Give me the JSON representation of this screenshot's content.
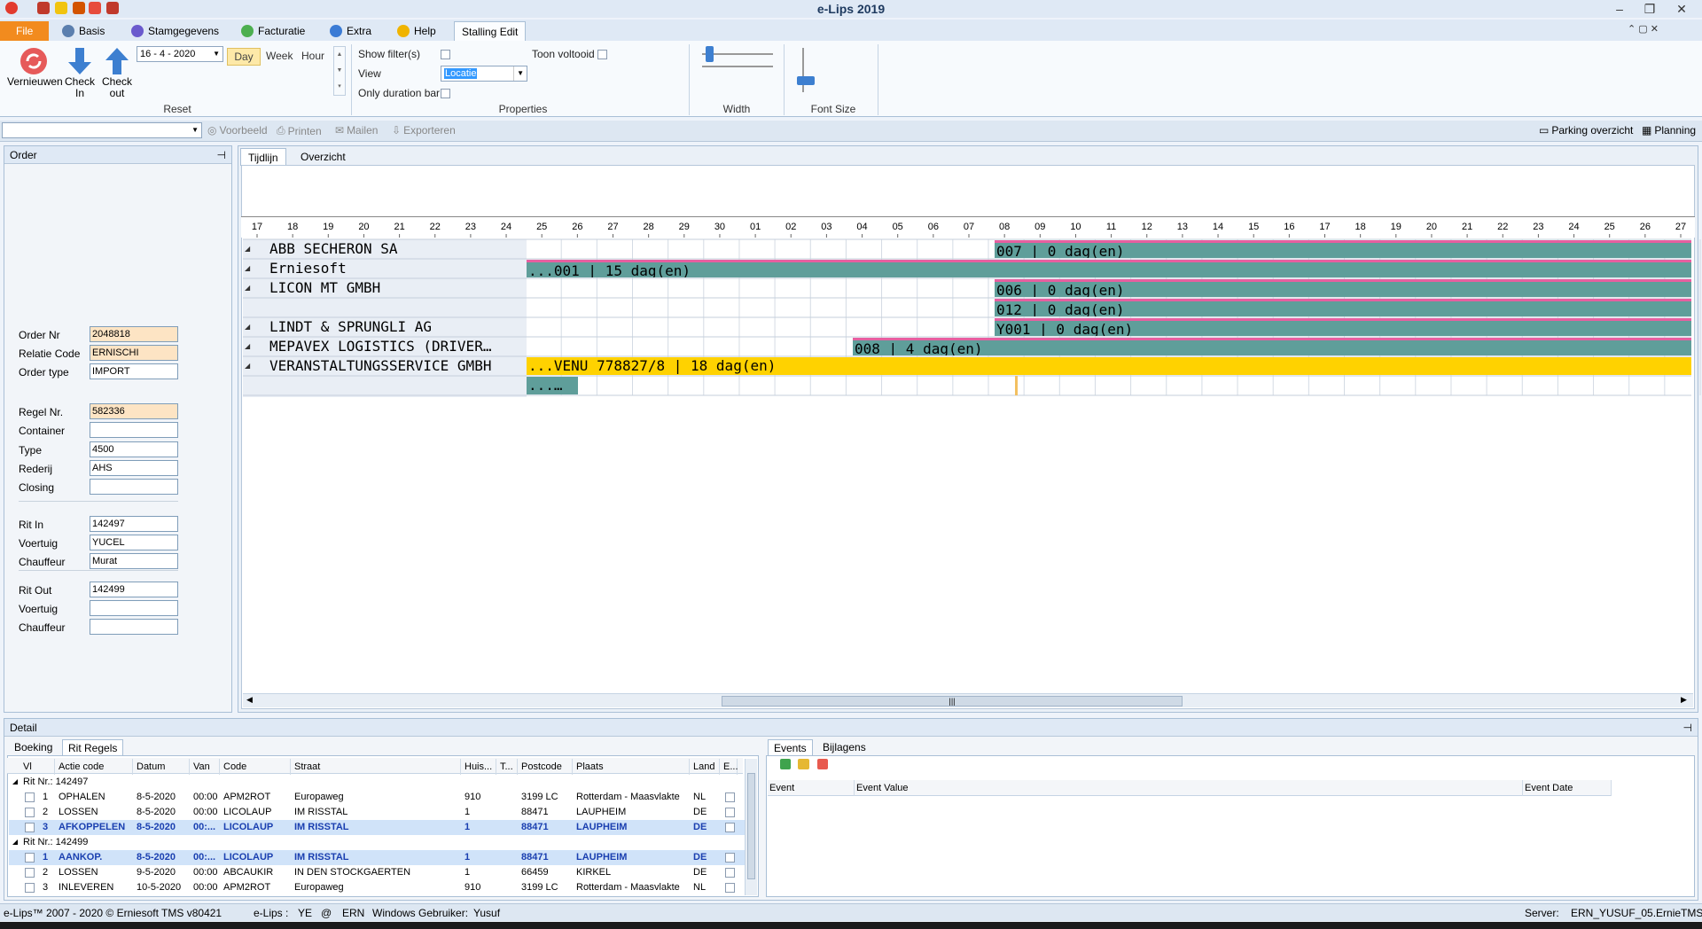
{
  "app": {
    "title": "e-Lips 2019"
  },
  "tabs": [
    "File",
    "Basis",
    "Stamgegevens",
    "Facturatie",
    "Extra",
    "Help",
    "Stalling Edit"
  ],
  "ribbon": {
    "reset": {
      "refresh": "Vernieuwen",
      "checkin": "Check\nIn",
      "checkout": "Check\nout",
      "date": "16 -  4 - 2020",
      "label": "Reset"
    },
    "views": {
      "day": "Day",
      "week": "Week",
      "hour": "Hour"
    },
    "properties": {
      "show_filters": "Show filter(s)",
      "toon_voltooid": "Toon voltooid",
      "view_label": "View",
      "view_value": "Locatie",
      "only_duration": "Only duration bar",
      "label": "Properties"
    },
    "width_label": "Width",
    "fontsize_label": "Font Size"
  },
  "toolbar2": {
    "preview": "Voorbeeld",
    "print": "Printen",
    "mail": "Mailen",
    "export": "Exporteren",
    "parking": "Parking overzicht",
    "planning": "Planning"
  },
  "order": {
    "title": "Order",
    "fields": [
      {
        "label": "Order Nr",
        "value": "2048818"
      },
      {
        "label": "Relatie Code",
        "value": "ERNISCHI"
      },
      {
        "label": "Order type",
        "value": "IMPORT"
      },
      {
        "label": "Regel Nr.",
        "value": "582336"
      },
      {
        "label": "Container",
        "value": ""
      },
      {
        "label": "Type",
        "value": "4500"
      },
      {
        "label": "Rederij",
        "value": "AHS"
      },
      {
        "label": "Closing",
        "value": ""
      },
      {
        "label": "Rit In",
        "value": "142497"
      },
      {
        "label": "Voertuig",
        "value": "YUCEL"
      },
      {
        "label": "Chauffeur",
        "value": "Murat"
      },
      {
        "label": "Rit Out",
        "value": "142499"
      },
      {
        "label": "Voertuig",
        "value": ""
      },
      {
        "label": "Chauffeur",
        "value": ""
      }
    ]
  },
  "timeline": {
    "tabs": [
      "Tijdlijn",
      "Overzicht"
    ],
    "ticks": [
      "17",
      "18",
      "19",
      "20",
      "21",
      "22",
      "23",
      "24",
      "25",
      "26",
      "27",
      "28",
      "29",
      "30",
      "01",
      "02",
      "03",
      "04",
      "05",
      "06",
      "07",
      "08",
      "09",
      "10",
      "11",
      "12",
      "13",
      "14",
      "15",
      "16",
      "17",
      "18",
      "19",
      "20",
      "21",
      "22",
      "23",
      "24",
      "25",
      "26",
      "27"
    ],
    "rows": [
      {
        "label": "ABB SECHERON SA",
        "bar": "007 | 0 dag(en)"
      },
      {
        "label": "Erniesoft",
        "bar": "...001 | 15 dag(en)"
      },
      {
        "label": "LICON MT GMBH",
        "bar": "006 | 0 dag(en)"
      },
      {
        "label": "",
        "bar": "012 | 0 dag(en)"
      },
      {
        "label": "LINDT & SPRUNGLI AG",
        "bar": "Y001 | 0 dag(en)"
      },
      {
        "label": "MEPAVEX LOGISTICS (DRIVER…",
        "bar": "008 | 4 dag(en)"
      },
      {
        "label": "VERANSTALTUNGSSERVICE GMBH",
        "bar": "...VENU 778827/8 | 18 dag(en)"
      },
      {
        "label": "",
        "bar": "...…"
      }
    ],
    "colors": {
      "teal": "#5f9e9a",
      "pink": "#e75fa0",
      "yellow": "#ffd200"
    }
  },
  "detail": {
    "title": "Detail",
    "tabs": [
      "Boeking",
      "Rit Regels"
    ],
    "columns": [
      "Vl",
      "Actie code",
      "Datum",
      "Van",
      "Code",
      "Straat",
      "Huis...",
      "T...",
      "Postcode",
      "Plaats",
      "Land",
      "E..."
    ],
    "groups": [
      {
        "header": "Rit Nr.: 142497",
        "rows": [
          [
            "1",
            "OPHALEN",
            "8-5-2020",
            "00:00",
            "APM2ROT",
            "Europaweg",
            "910",
            "",
            "3199 LC",
            "Rotterdam - Maasvlakte",
            "NL"
          ],
          [
            "2",
            "LOSSEN",
            "8-5-2020",
            "00:00",
            "LICOLAUP",
            "IM RISSTAL",
            "1",
            "",
            "88471",
            "LAUPHEIM",
            "DE"
          ],
          [
            "3",
            "AFKOPPELEN",
            "8-5-2020",
            "00:...",
            "LICOLAUP",
            "IM RISSTAL",
            "1",
            "",
            "88471",
            "LAUPHEIM",
            "DE"
          ]
        ]
      },
      {
        "header": "Rit Nr.: 142499",
        "rows": [
          [
            "1",
            "AANKOP.",
            "8-5-2020",
            "00:...",
            "LICOLAUP",
            "IM RISSTAL",
            "1",
            "",
            "88471",
            "LAUPHEIM",
            "DE"
          ],
          [
            "2",
            "LOSSEN",
            "9-5-2020",
            "00:00",
            "ABCAUKIR",
            "IN DEN STOCKGAERTEN",
            "1",
            "",
            "66459",
            "KIRKEL",
            "DE"
          ],
          [
            "3",
            "INLEVEREN",
            "10-5-2020",
            "00:00",
            "APM2ROT",
            "Europaweg",
            "910",
            "",
            "3199 LC",
            "Rotterdam - Maasvlakte",
            "NL"
          ]
        ]
      }
    ]
  },
  "events": {
    "tabs": [
      "Events",
      "Bijlagens"
    ],
    "columns": [
      "Event",
      "Event Value",
      "Event Date"
    ]
  },
  "status": {
    "copyright": "e-Lips™ 2007 - 2020 © Erniesoft TMS v80421",
    "elips": "e-Lips :",
    "ye": "YE",
    "at": "@",
    "ern": "ERN",
    "win": "Windows Gebruiker:",
    "user": "Yusuf",
    "server_label": "Server:",
    "server": "ERN_YUSUF_05.ErnieTMS"
  }
}
